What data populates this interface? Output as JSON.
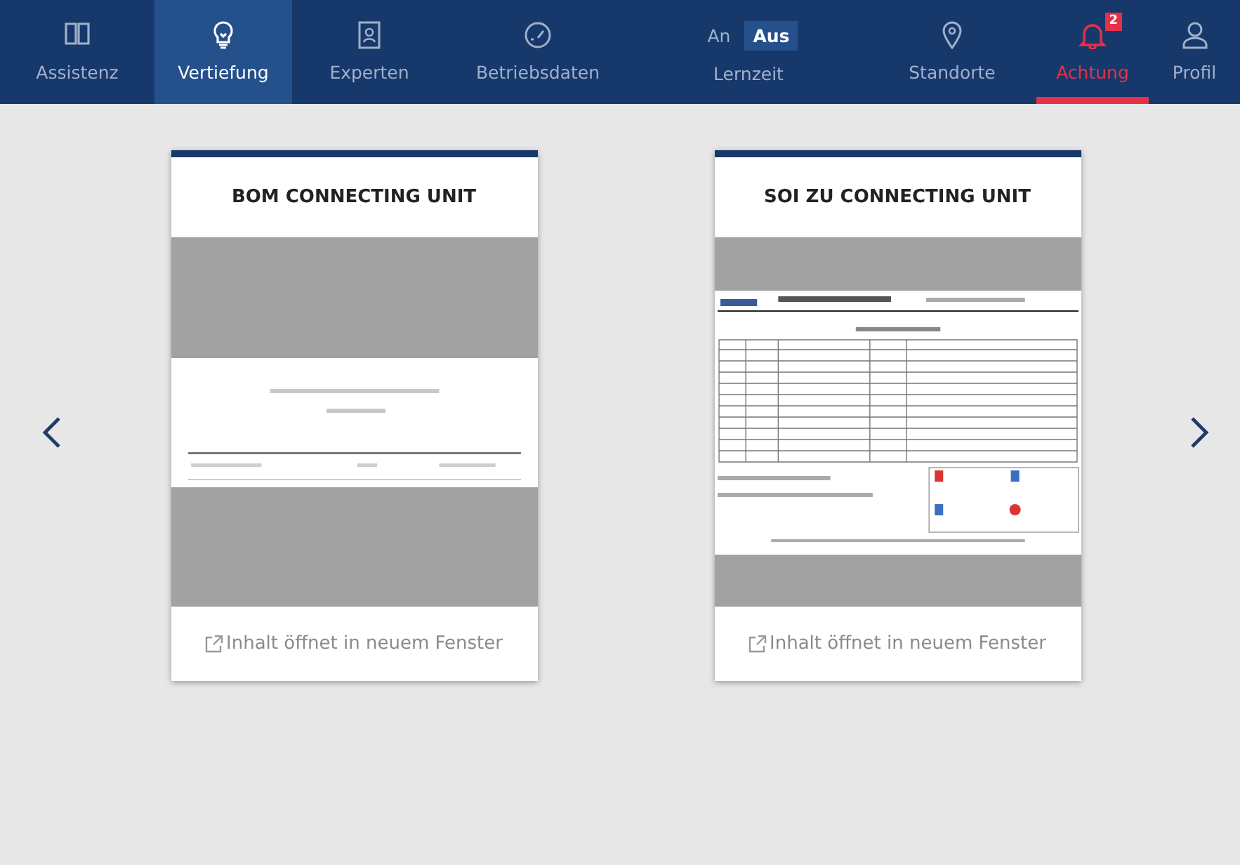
{
  "nav": [
    {
      "kind": "tab",
      "label": "Assistenz",
      "selected": false
    },
    {
      "kind": "tab",
      "label": "Vertiefung",
      "selected": true
    },
    {
      "kind": "tab",
      "label": "Experten",
      "selected": false
    },
    {
      "kind": "tab",
      "label": "Betriebsdaten",
      "selected": false
    },
    {
      "kind": "toggle",
      "label": "Lernzeit",
      "options": [
        {
          "label": "An",
          "selected": false
        },
        {
          "label": "Aus",
          "selected": true
        }
      ]
    },
    {
      "kind": "tab",
      "label": "Standorte",
      "selected": false
    },
    {
      "kind": "tab",
      "label": "Achtung",
      "selected": false,
      "alert": true,
      "badge": "2"
    },
    {
      "kind": "tab",
      "label": "Profil",
      "selected": false
    }
  ],
  "cards": [
    {
      "title": "BOM CONNECTING UNIT",
      "link": "Inhalt öffnet in neuem Fenster"
    },
    {
      "title": "SOI ZU CONNECTING UNIT",
      "link": "Inhalt öffnet in neuem Fenster"
    }
  ]
}
